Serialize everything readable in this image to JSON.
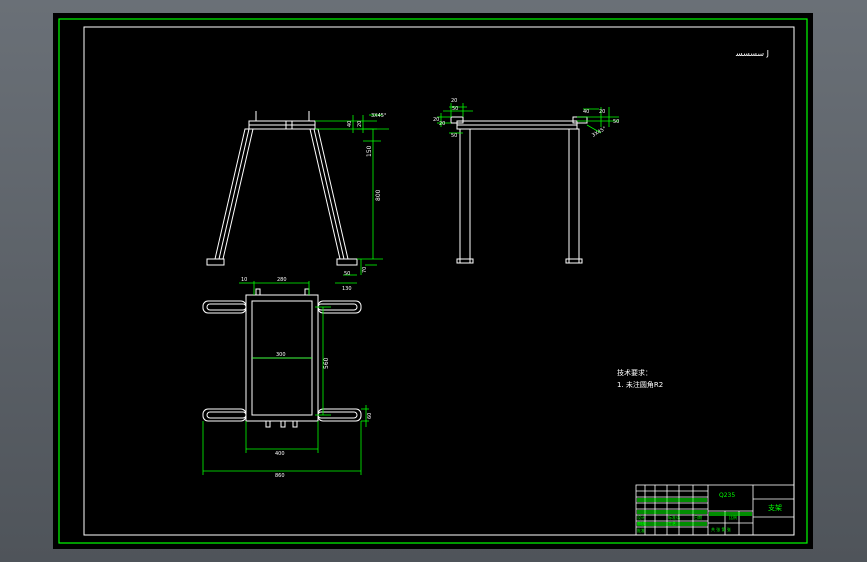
{
  "drawing": {
    "top_note": "ﺳﺴﺴﺴ  J",
    "tech_req_title": "技术要求：",
    "tech_req_item": "1. 未注圆角R2",
    "colors": {
      "background": "#000000",
      "geometry": "#ffffff",
      "dimension": "#00ff00",
      "frame_outer": "#00ff00",
      "frame_inner": "#ffffff"
    },
    "front_view": {
      "dims": {
        "top_thickness": "40",
        "top_small": "20",
        "angle": "3X45°",
        "height_upper": "150",
        "height_main": "800",
        "foot_height": "70",
        "foot_width_a": "50",
        "foot_width_b": "130"
      }
    },
    "side_view": {
      "dims": {
        "left_top_a": "20",
        "left_top_b": "50",
        "left_side_a": "20",
        "left_side_b": "20",
        "left_side_c": "50",
        "right_a": "40",
        "right_b": "20",
        "right_c": "50",
        "right_d": "3X45°"
      }
    },
    "top_view": {
      "dims": {
        "left_gap": "10",
        "top_width": "280",
        "inner_width": "300",
        "height": "560",
        "right_offset": "60",
        "bottom_inner": "400",
        "bottom_total": "860"
      }
    },
    "title_block": {
      "material": "Q235",
      "name": "支架",
      "scale_label": "比例",
      "sheet_label": "共 张 第 张",
      "designer_label": "设计",
      "checker_label": "审核",
      "approve_label": "批准",
      "process_label": "工艺",
      "standard_label": "标准化",
      "date_label": "日期"
    }
  }
}
